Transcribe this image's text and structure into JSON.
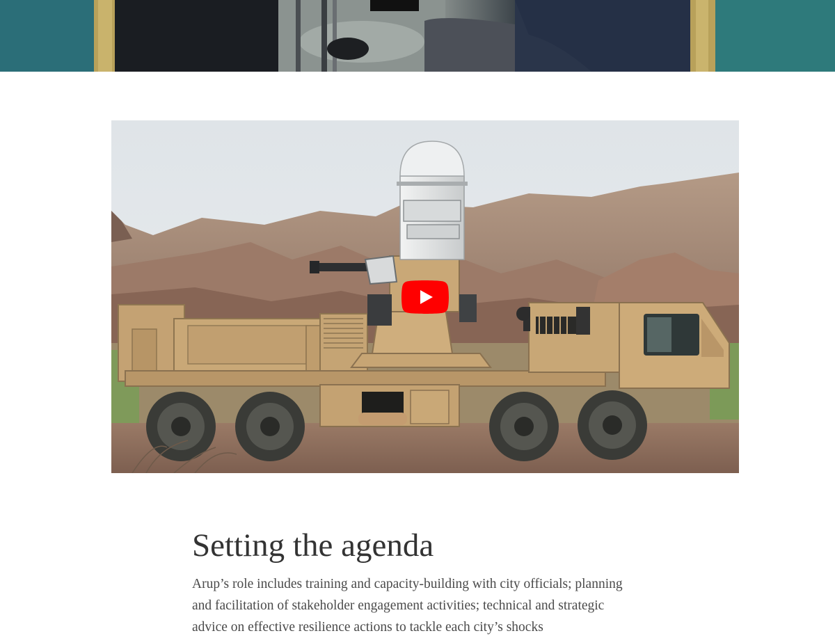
{
  "hero": {
    "image_alt": "photo-top-crop"
  },
  "video": {
    "thumbnail": "military-vehicle-thumbnail",
    "play_icon": "play-icon",
    "colors": {
      "play_red": "#ff0000",
      "vehicle_tan": "#c9a877",
      "sky": "#e3e7ea",
      "ground": "#8a6a58"
    }
  },
  "article": {
    "heading": "Setting the agenda",
    "body": "Arup’s role includes training and capacity-building with city officials; planning and facilitation of stakeholder engagement activities; technical and strategic advice on effective resilience actions to tackle each city’s shocks"
  }
}
